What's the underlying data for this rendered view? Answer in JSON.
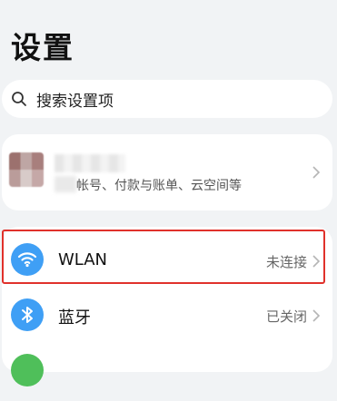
{
  "page": {
    "title": "设置"
  },
  "search": {
    "placeholder": "搜索设置项",
    "icon": "search-icon"
  },
  "account": {
    "subtitle": "帐号、付款与账单、云空间等"
  },
  "settings": [
    {
      "label": "WLAN",
      "status": "未连接",
      "icon": "wifi-icon",
      "color": "#3f9ff5"
    },
    {
      "label": "蓝牙",
      "status": "已关闭",
      "icon": "bluetooth-icon",
      "color": "#3f9ff5"
    }
  ],
  "colors": {
    "highlight": "#e0312b",
    "background": "#f1f3f5",
    "green_icon": "#4fbf5a"
  }
}
